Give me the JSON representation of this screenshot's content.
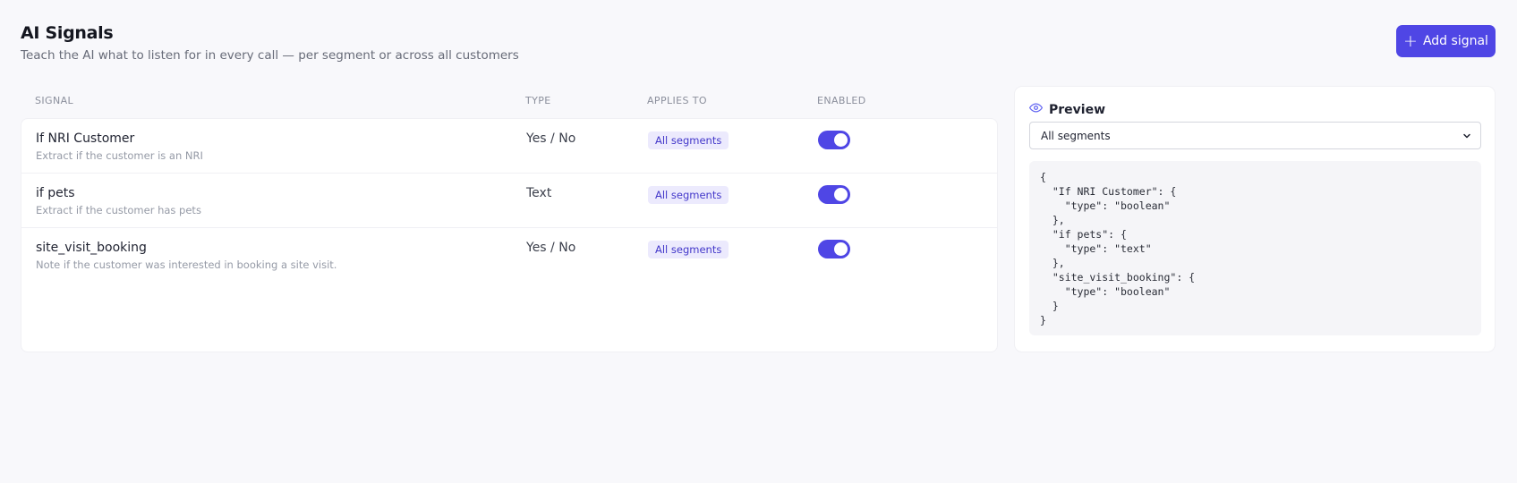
{
  "page": {
    "title": "AI Signals",
    "subtitle": "Teach the AI what to listen for in every call — per segment or across all customers",
    "add_button_label": "Add signal",
    "add_button_icon": "plus-icon"
  },
  "table": {
    "columns": [
      "SIGNAL",
      "TYPE",
      "APPLIES TO",
      "ENABLED"
    ],
    "rows": [
      {
        "name": "If NRI Customer",
        "description": "Extract if the customer is an NRI",
        "type": "Yes / No",
        "applies_to": "All segments",
        "enabled": true
      },
      {
        "name": "if pets",
        "description": "Extract if the customer has pets",
        "type": "Text",
        "applies_to": "All segments",
        "enabled": true
      },
      {
        "name": "site_visit_booking",
        "description": "Note if the customer was interested in booking a site visit.",
        "type": "Yes / No",
        "applies_to": "All segments",
        "enabled": true
      }
    ]
  },
  "preview": {
    "title": "Preview",
    "icon": "eye-icon",
    "segment_selected": "All segments",
    "json_text": "{\n  \"If NRI Customer\": {\n    \"type\": \"boolean\"\n  },\n  \"if pets\": {\n    \"type\": \"text\"\n  },\n  \"site_visit_booking\": {\n    \"type\": \"boolean\"\n  }\n}"
  },
  "colors": {
    "accent": "#4f46e5",
    "pill_bg": "#eceafd",
    "background": "#f8f8fb"
  }
}
